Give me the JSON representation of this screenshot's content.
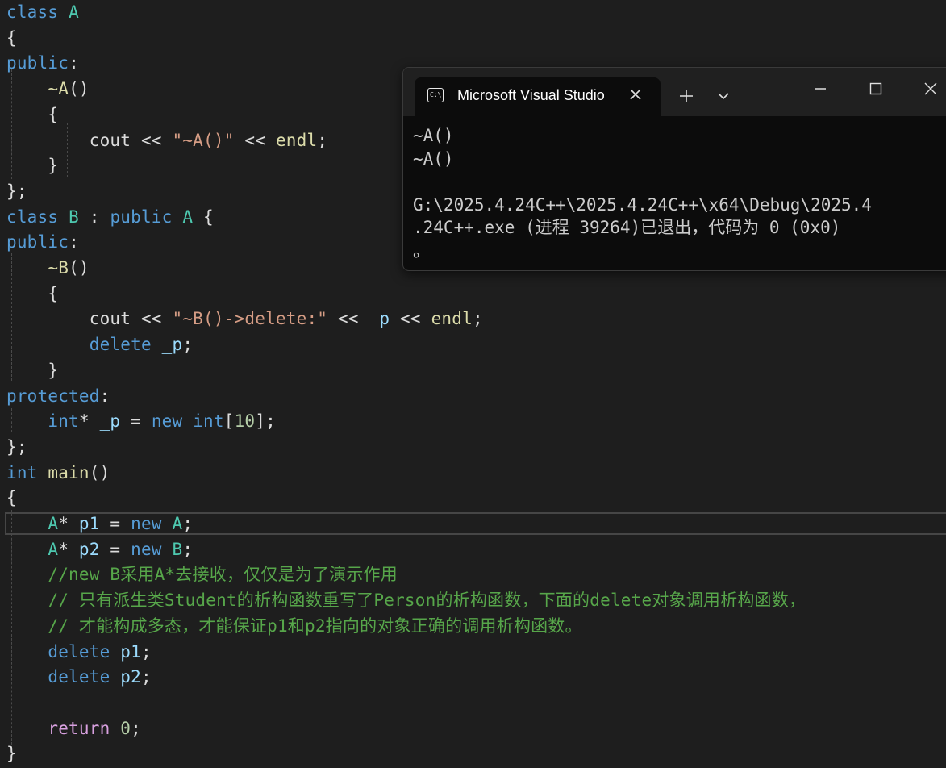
{
  "editor": {
    "lines": [
      {
        "tokens": [
          {
            "t": "class ",
            "c": "kw"
          },
          {
            "t": "A",
            "c": "ty"
          }
        ]
      },
      {
        "tokens": [
          {
            "t": "{",
            "c": "pun"
          }
        ]
      },
      {
        "tokens": [
          {
            "t": "public",
            "c": "kw"
          },
          {
            "t": ":",
            "c": "pun"
          }
        ]
      },
      {
        "tokens": [
          {
            "t": "    ",
            "c": "pun"
          },
          {
            "t": "~A",
            "c": "fn"
          },
          {
            "t": "()",
            "c": "pun"
          }
        ]
      },
      {
        "tokens": [
          {
            "t": "    {",
            "c": "pun"
          }
        ]
      },
      {
        "tokens": [
          {
            "t": "        cout << ",
            "c": "pun"
          },
          {
            "t": "\"~A()\"",
            "c": "str"
          },
          {
            "t": " << ",
            "c": "pun"
          },
          {
            "t": "endl",
            "c": "fn"
          },
          {
            "t": ";",
            "c": "pun"
          }
        ]
      },
      {
        "tokens": [
          {
            "t": "    }",
            "c": "pun"
          }
        ]
      },
      {
        "tokens": [
          {
            "t": "};",
            "c": "pun"
          }
        ]
      },
      {
        "tokens": [
          {
            "t": "class ",
            "c": "kw"
          },
          {
            "t": "B",
            "c": "ty"
          },
          {
            "t": " : ",
            "c": "pun"
          },
          {
            "t": "public ",
            "c": "kw"
          },
          {
            "t": "A",
            "c": "ty"
          },
          {
            "t": " {",
            "c": "pun"
          }
        ]
      },
      {
        "tokens": [
          {
            "t": "public",
            "c": "kw"
          },
          {
            "t": ":",
            "c": "pun"
          }
        ]
      },
      {
        "tokens": [
          {
            "t": "    ",
            "c": "pun"
          },
          {
            "t": "~B",
            "c": "fn"
          },
          {
            "t": "()",
            "c": "pun"
          }
        ]
      },
      {
        "tokens": [
          {
            "t": "    {",
            "c": "pun"
          }
        ]
      },
      {
        "tokens": [
          {
            "t": "        cout << ",
            "c": "pun"
          },
          {
            "t": "\"~B()->delete:\"",
            "c": "str"
          },
          {
            "t": " << ",
            "c": "pun"
          },
          {
            "t": "_p",
            "c": "var"
          },
          {
            "t": " << ",
            "c": "pun"
          },
          {
            "t": "endl",
            "c": "fn"
          },
          {
            "t": ";",
            "c": "pun"
          }
        ]
      },
      {
        "tokens": [
          {
            "t": "        ",
            "c": "pun"
          },
          {
            "t": "delete ",
            "c": "kw"
          },
          {
            "t": "_p",
            "c": "var"
          },
          {
            "t": ";",
            "c": "pun"
          }
        ]
      },
      {
        "tokens": [
          {
            "t": "    }",
            "c": "pun"
          }
        ]
      },
      {
        "tokens": [
          {
            "t": "protected",
            "c": "kw"
          },
          {
            "t": ":",
            "c": "pun"
          }
        ]
      },
      {
        "tokens": [
          {
            "t": "    ",
            "c": "pun"
          },
          {
            "t": "int",
            "c": "kw"
          },
          {
            "t": "* ",
            "c": "pun"
          },
          {
            "t": "_p",
            "c": "var"
          },
          {
            "t": " = ",
            "c": "pun"
          },
          {
            "t": "new ",
            "c": "kw"
          },
          {
            "t": "int",
            "c": "kw"
          },
          {
            "t": "[",
            "c": "pun"
          },
          {
            "t": "10",
            "c": "num"
          },
          {
            "t": "];",
            "c": "pun"
          }
        ]
      },
      {
        "tokens": [
          {
            "t": "};",
            "c": "pun"
          }
        ]
      },
      {
        "tokens": [
          {
            "t": "int ",
            "c": "kw"
          },
          {
            "t": "main",
            "c": "fn"
          },
          {
            "t": "()",
            "c": "pun"
          }
        ]
      },
      {
        "tokens": [
          {
            "t": "{",
            "c": "pun"
          }
        ]
      },
      {
        "tokens": [
          {
            "t": "    ",
            "c": "pun"
          },
          {
            "t": "A",
            "c": "ty"
          },
          {
            "t": "* ",
            "c": "pun"
          },
          {
            "t": "p1",
            "c": "var"
          },
          {
            "t": " = ",
            "c": "pun"
          },
          {
            "t": "new ",
            "c": "kw"
          },
          {
            "t": "A",
            "c": "ty"
          },
          {
            "t": ";",
            "c": "pun"
          }
        ]
      },
      {
        "tokens": [
          {
            "t": "    ",
            "c": "pun"
          },
          {
            "t": "A",
            "c": "ty"
          },
          {
            "t": "* ",
            "c": "pun"
          },
          {
            "t": "p2",
            "c": "var"
          },
          {
            "t": " = ",
            "c": "pun"
          },
          {
            "t": "new ",
            "c": "kw"
          },
          {
            "t": "B",
            "c": "ty"
          },
          {
            "t": ";",
            "c": "pun"
          }
        ]
      },
      {
        "tokens": [
          {
            "t": "    //new B采用A*去接收，仅仅是为了演示作用",
            "c": "cm"
          }
        ]
      },
      {
        "tokens": [
          {
            "t": "    // 只有派生类Student的析构函数重写了Person的析构函数，下面的delete对象调用析构函数，",
            "c": "cm"
          }
        ]
      },
      {
        "tokens": [
          {
            "t": "    // 才能构成多态，才能保证p1和p2指向的对象正确的调用析构函数。",
            "c": "cm"
          }
        ]
      },
      {
        "tokens": [
          {
            "t": "    ",
            "c": "pun"
          },
          {
            "t": "delete ",
            "c": "kw"
          },
          {
            "t": "p1",
            "c": "var"
          },
          {
            "t": ";",
            "c": "pun"
          }
        ]
      },
      {
        "tokens": [
          {
            "t": "    ",
            "c": "pun"
          },
          {
            "t": "delete ",
            "c": "kw"
          },
          {
            "t": "p2",
            "c": "var"
          },
          {
            "t": ";",
            "c": "pun"
          }
        ]
      },
      {
        "tokens": []
      },
      {
        "tokens": [
          {
            "t": "    ",
            "c": "pun"
          },
          {
            "t": "return ",
            "c": "kw2"
          },
          {
            "t": "0",
            "c": "num"
          },
          {
            "t": ";",
            "c": "pun"
          }
        ]
      },
      {
        "tokens": [
          {
            "t": "}",
            "c": "pun"
          }
        ]
      }
    ]
  },
  "terminal": {
    "tab_icon_text": "C:\\",
    "tab_title": "Microsoft Visual Studio",
    "output_lines": [
      "~A()",
      "~A()",
      "",
      "G:\\2025.4.24C++\\2025.4.24C++\\x64\\Debug\\2025.4",
      ".24C++.exe (进程 39264)已退出，代码为 0 (0x0)",
      "。"
    ]
  },
  "colors": {
    "editor_bg": "#1e1e1e",
    "keyword": "#569cd6",
    "control_keyword": "#d8a0df",
    "type": "#4ec9b0",
    "function": "#dcdcaa",
    "variable": "#9cdcfe",
    "string": "#d69d85",
    "number": "#b5cea8",
    "comment": "#57a64a",
    "terminal_bg": "#0c0c0c",
    "titlebar_bg": "#202020"
  },
  "icons": [
    "terminal-icon",
    "close-icon",
    "plus-icon",
    "chevron-down-icon",
    "minimize-icon",
    "maximize-icon",
    "close-window-icon"
  ]
}
